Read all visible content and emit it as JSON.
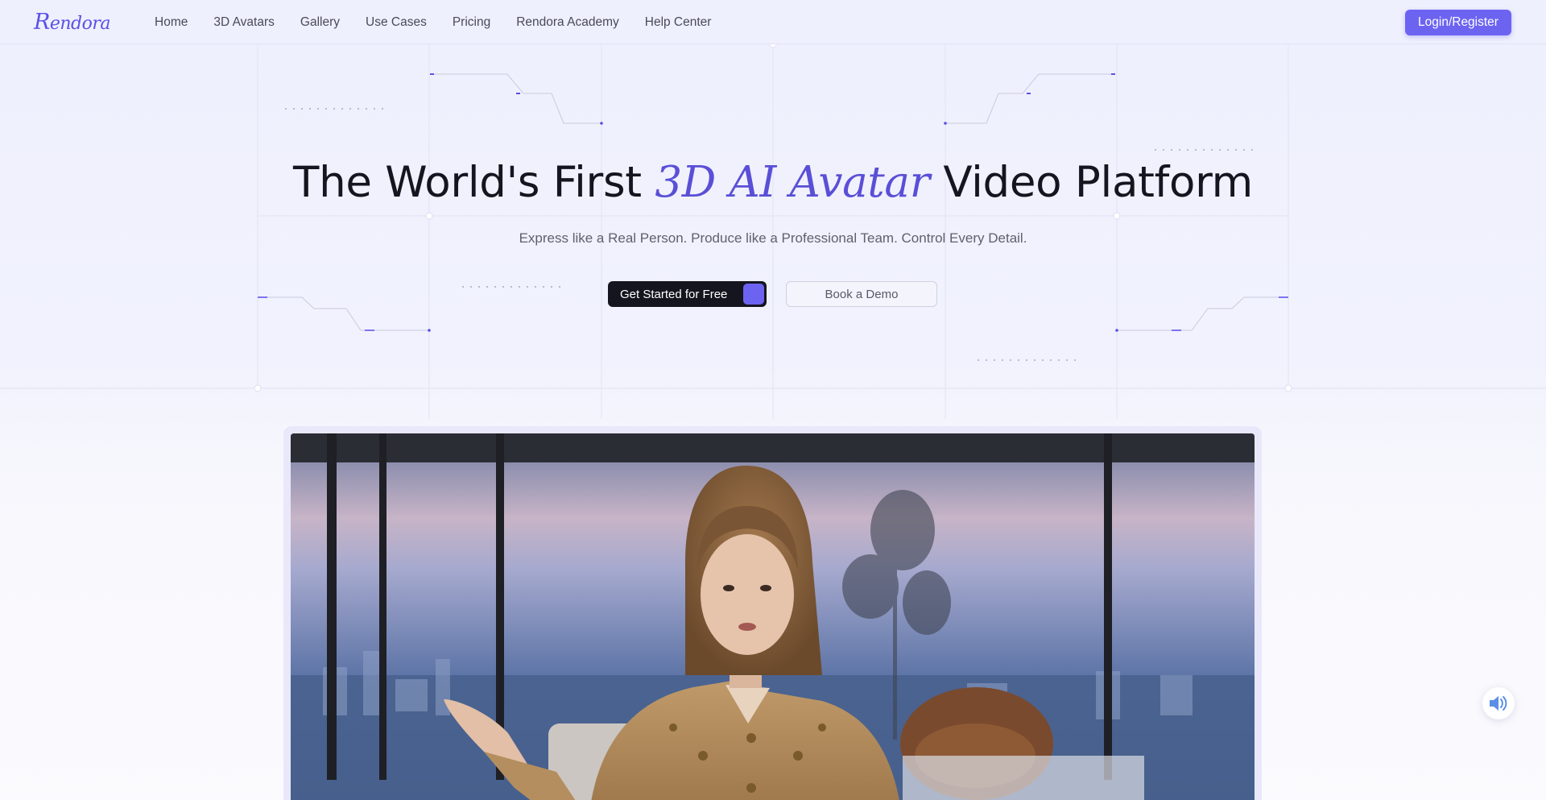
{
  "brand": {
    "logo_text": "Rendora",
    "accent_color": "#6c63f1",
    "title_accent_color": "#5a4fd6"
  },
  "nav": {
    "items": [
      {
        "label": "Home"
      },
      {
        "label": "3D Avatars"
      },
      {
        "label": "Gallery"
      },
      {
        "label": "Use Cases"
      },
      {
        "label": "Pricing"
      },
      {
        "label": "Rendora Academy"
      },
      {
        "label": "Help Center"
      }
    ],
    "login_label": "Login/Register"
  },
  "hero": {
    "title_before": "The World's First ",
    "title_accent": "3D AI Avatar",
    "title_after": " Video Platform",
    "subtitle": "Express like a Real Person. Produce like a Professional Team. Control Every Detail.",
    "primary_cta": "Get Started for Free",
    "secondary_cta": "Book a Demo"
  },
  "video": {
    "content": "3D avatar presenter in office scene"
  },
  "icons": {
    "sound": "speaker-icon"
  }
}
